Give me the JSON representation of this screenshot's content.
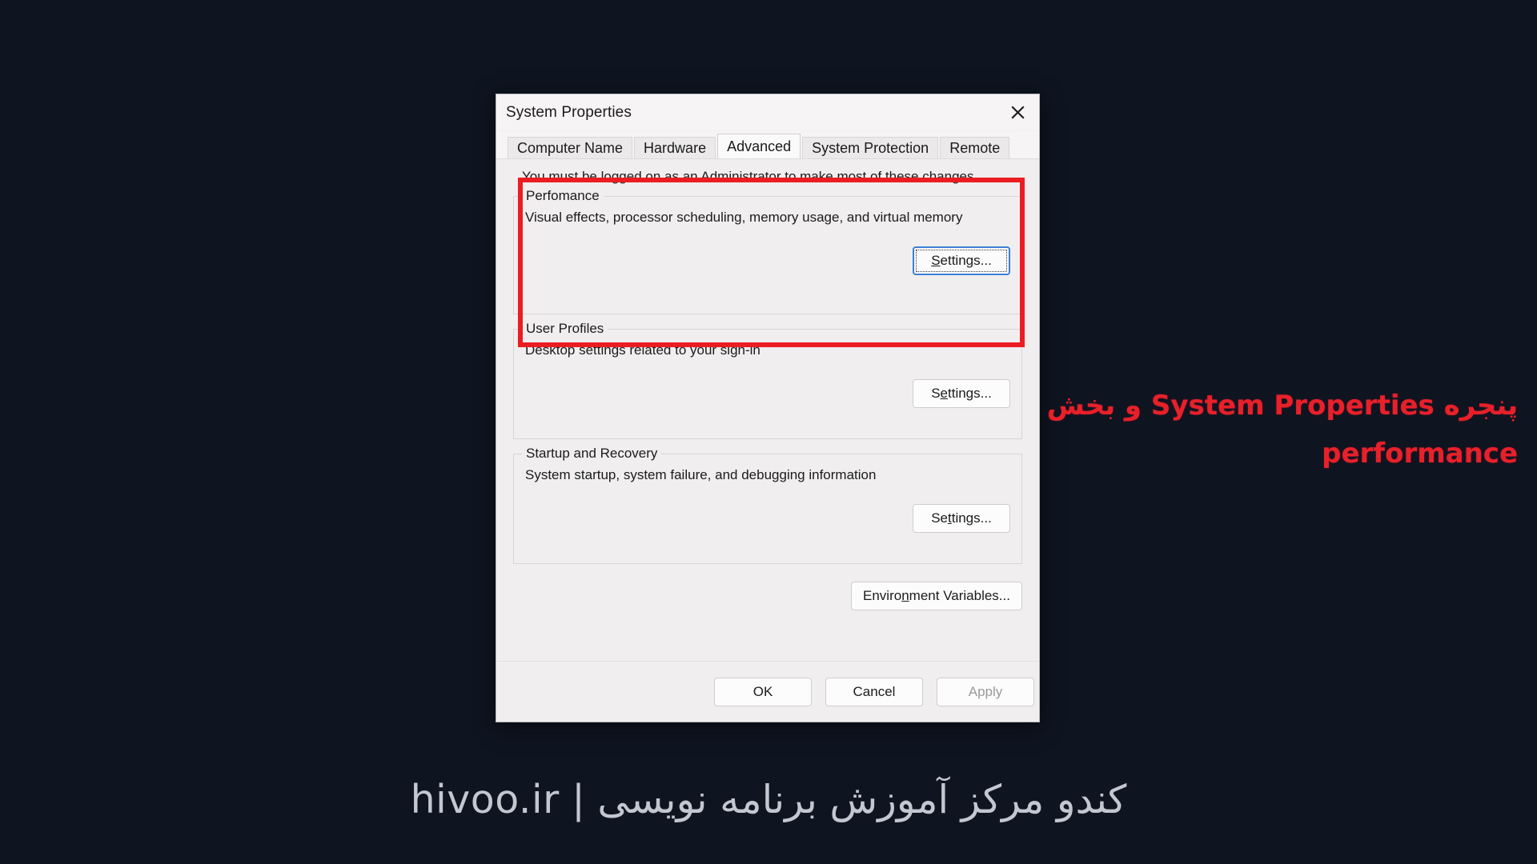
{
  "window": {
    "title": "System Properties",
    "close_icon": "close-icon"
  },
  "tabs": [
    {
      "label": "Computer Name",
      "active": false
    },
    {
      "label": "Hardware",
      "active": false
    },
    {
      "label": "Advanced",
      "active": true
    },
    {
      "label": "System Protection",
      "active": false
    },
    {
      "label": "Remote",
      "active": false
    }
  ],
  "advanced": {
    "admin_note": "You must be logged on as an Administrator to make most of these changes.",
    "performance": {
      "legend": "Perfomance",
      "description": "Visual effects, processor scheduling, memory usage, and virtual memory",
      "settings_label": "Settings...",
      "settings_mnemonic": "S",
      "focused": true
    },
    "user_profiles": {
      "legend": "User Profiles",
      "description": "Desktop settings related to your sign-in",
      "settings_label": "Settings...",
      "settings_mnemonic": "e"
    },
    "startup_recovery": {
      "legend": "Startup and Recovery",
      "description": "System startup, system failure, and debugging information",
      "settings_label": "Settings...",
      "settings_mnemonic": "t"
    },
    "environment_variables_label": "Environment Variables...",
    "environment_variables_mnemonic": "n"
  },
  "footer": {
    "ok_label": "OK",
    "cancel_label": "Cancel",
    "apply_label": "Apply",
    "apply_enabled": false
  },
  "annotation": {
    "line1": "پنجره System Properties و بخش",
    "line2": "performance",
    "color": "#e8202a"
  },
  "highlight": {
    "color": "#ec1c23",
    "target": "performance-section"
  },
  "watermark": {
    "text": "کندو مرکز آموزش برنامه نویسی | hivoo.ir",
    "color": "#c2c7d0"
  },
  "desktop": {
    "background_color": "#0e1420"
  }
}
